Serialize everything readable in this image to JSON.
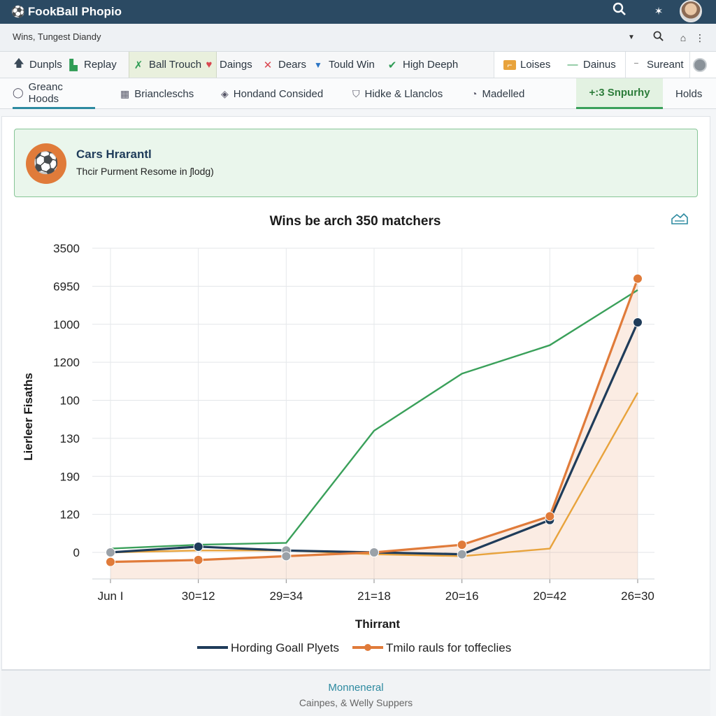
{
  "app": {
    "title": "FookBall Phopio",
    "logo_icon": "soccer-ball-icon"
  },
  "subbar": {
    "crumb": "Wins, Tungest Diandy"
  },
  "toolbar": {
    "items": [
      {
        "label": "Dunpls",
        "icon": "upload-arrow-icon",
        "color": "#3b4a58"
      },
      {
        "label": "Replay",
        "icon": "replay-icon",
        "color": "#2f9c55"
      },
      {
        "label": "Ball Trouch",
        "icon": "ball-touch-icon",
        "color": "#2f9c55"
      },
      {
        "label": "Daings",
        "icon": "heart-icon",
        "color": "#d9464f"
      },
      {
        "label": "Dears",
        "icon": "close-x-icon",
        "color": "#d9464f"
      },
      {
        "label": "Tould Win",
        "icon": "triangle-down-icon",
        "color": "#2a74c4"
      },
      {
        "label": "High Deeph",
        "icon": "check-icon",
        "color": "#2f9c55"
      }
    ],
    "right_items": [
      {
        "label": "Loises",
        "icon": "bracket-icon",
        "color": "#e8a33c"
      },
      {
        "label": "Dainus",
        "icon": "dash-icon",
        "color": "#2f9c55"
      },
      {
        "label": "Sureant",
        "icon": "minus-line-icon",
        "color": "#555"
      }
    ]
  },
  "tabs": [
    {
      "label": "Greanc Hoods",
      "icon": "shield-outline-icon"
    },
    {
      "label": "Briancleschs",
      "icon": "grid-icon"
    },
    {
      "label": "Hondand Consided",
      "icon": "badge-icon"
    },
    {
      "label": "Hidke & Llanclos",
      "icon": "shield-icon"
    },
    {
      "label": "Madelled",
      "icon": "refresh-icon"
    },
    {
      "label": "+:3 Snpurhy",
      "icon": ""
    },
    {
      "label": "Holds",
      "icon": ""
    }
  ],
  "banner": {
    "title": "Cars Hrarantl",
    "subtitle": "Thcir Purment Resome in ʃlodg)",
    "icon": "ball-icon"
  },
  "chart_data": {
    "type": "line",
    "title": "Wins be arch 350 matchers",
    "xlabel": "Thirrant",
    "ylabel": "Lierleer Fisaths",
    "y_tick_labels": [
      "3500",
      "6950",
      "1000",
      "1200",
      "100",
      "130",
      "190",
      "120",
      "0"
    ],
    "x": [
      "Jun I",
      "30=12",
      "29=34",
      "21=18",
      "20=16",
      "20=42",
      "26=30"
    ],
    "ylim": [
      0,
      8
    ],
    "grid": true,
    "legend_position": "bottom",
    "series": [
      {
        "name": "Hording Goall Plyets",
        "color": "#1f3c5a",
        "values": [
          0.0,
          0.15,
          0.05,
          0.0,
          -0.05,
          0.85,
          6.05
        ],
        "markers": true
      },
      {
        "name": "Tmilo rauls for toffeclies",
        "color": "#e07b3a",
        "values": [
          -0.25,
          -0.2,
          -0.1,
          0.0,
          0.2,
          0.95,
          7.2
        ],
        "markers": true,
        "fill": true
      },
      {
        "color": "#3aa05a",
        "values": [
          0.1,
          0.2,
          0.25,
          3.2,
          4.7,
          5.45,
          6.9
        ],
        "markers": false
      },
      {
        "color": "#e8a33c",
        "values": [
          0.0,
          0.05,
          0.05,
          -0.05,
          -0.1,
          0.1,
          4.2
        ],
        "markers": false
      }
    ]
  },
  "footer": {
    "line1": "Monneneral",
    "line2": "Cainpes, & Welly Suppers"
  }
}
